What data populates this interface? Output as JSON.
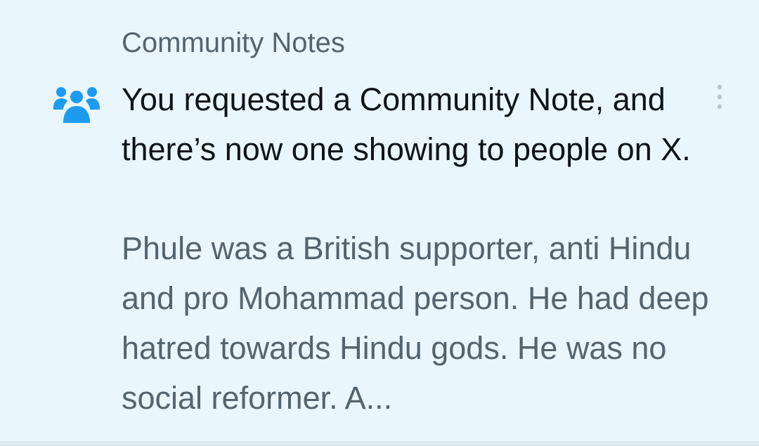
{
  "notification": {
    "header": "Community Notes",
    "icon": "community-people-icon",
    "more_icon": "more-vertical-icon",
    "title": "You requested a Community Note, and there’s now one showing to people on X.",
    "note_text": "Phule was a British supporter, anti Hindu and pro Mohammad person. He had deep hatred towards Hindu gods. He was no social reformer. A..."
  },
  "colors": {
    "background": "#eaf6fd",
    "accent": "#1d9bf0",
    "primary_text": "#0f1419",
    "secondary_text": "#536471"
  }
}
